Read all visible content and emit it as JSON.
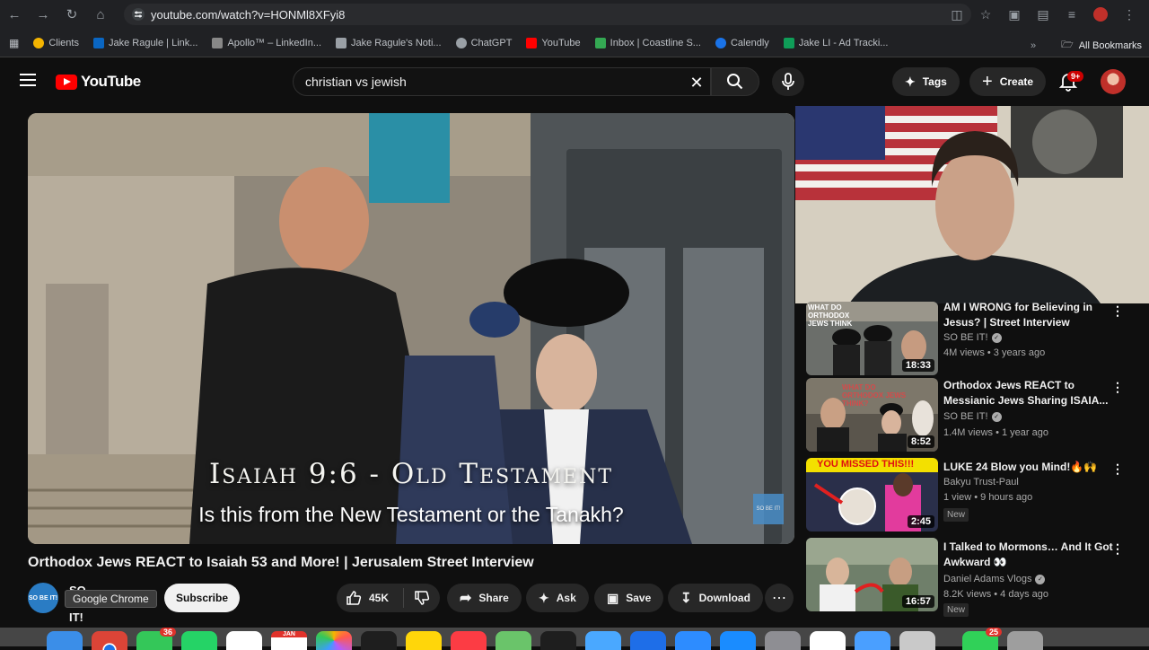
{
  "browser": {
    "url": "youtube.com/watch?v=HONMl8XFyi8",
    "bookmarks": [
      {
        "label": "Clients",
        "color": "#f4b400"
      },
      {
        "label": "Jake Ragule | Link...",
        "color": "#0a66c2"
      },
      {
        "label": "Apollo™ – LinkedIn...",
        "color": "#888888"
      },
      {
        "label": "Jake Ragule's Noti...",
        "color": "#9aa0a6"
      },
      {
        "label": "ChatGPT",
        "color": "#9aa0a6"
      },
      {
        "label": "YouTube",
        "color": "#ff0000"
      },
      {
        "label": "Inbox | Coastline S...",
        "color": "#34a853"
      },
      {
        "label": "Calendly",
        "color": "#1a73e8"
      },
      {
        "label": "Jake LI - Ad Tracki...",
        "color": "#0f9d58"
      }
    ],
    "all_bookmarks": "All Bookmarks"
  },
  "youtube": {
    "logo_text": "YouTube",
    "search_query": "christian vs jewish",
    "tags_label": "Tags",
    "create_label": "Create",
    "notifications_badge": "9+"
  },
  "video": {
    "overlay_title": "Isaiah 9:6 - Old Testament",
    "overlay_subtitle": "Is this from the New Testament or the Tanakh?",
    "watermark": "SO BE IT!",
    "title": "Orthodox Jews REACT to Isaiah 53 and More! | Jerusalem Street Interview",
    "channel_name": "SO BE IT!",
    "channel_avatar_text": "SO BE IT!",
    "tooltip": "Google Chrome",
    "subscribe_label": "Subscribe",
    "likes": "45K",
    "share_label": "Share",
    "ask_label": "Ask",
    "save_label": "Save",
    "download_label": "Download"
  },
  "recommendations": [
    {
      "title": "AM I WRONG for Believing in Jesus? | Street Interview",
      "channel": "SO BE IT!",
      "verified": true,
      "meta": "4M views • 3 years ago",
      "duration": "18:33",
      "thumb_text": "WHAT DO ORTHODOX JEWS THINK",
      "new": ""
    },
    {
      "title": "Orthodox Jews REACT to Messianic Jews Sharing ISAIA...",
      "channel": "SO BE IT!",
      "verified": true,
      "meta": "1.4M views • 1 year ago",
      "duration": "8:52",
      "thumb_text": "WHAT DO ORTHODOX JEWS THINK?",
      "new": ""
    },
    {
      "title": "LUKE 24 Blow you Mind!🔥🙌",
      "channel": "Bakyu Trust-Paul",
      "verified": false,
      "meta": "1 view • 9 hours ago",
      "duration": "2:45",
      "thumb_text": "YOU MISSED THIS!!!",
      "new": "New"
    },
    {
      "title": "I Talked to Mormons… And It Got Awkward 👀",
      "channel": "Daniel Adams Vlogs",
      "verified": true,
      "meta": "8.2K views • 4 days ago",
      "duration": "16:57",
      "thumb_text": "",
      "new": "New"
    }
  ],
  "dock": {
    "badges": [
      "36",
      "25"
    ],
    "calendar_month": "JAN"
  }
}
